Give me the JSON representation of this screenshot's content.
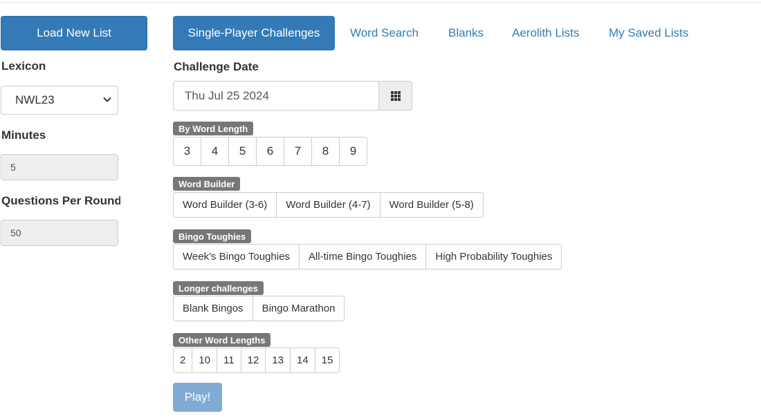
{
  "sidebar": {
    "load_button": "Load New List",
    "lexicon_label": "Lexicon",
    "lexicon_value": "NWL23",
    "minutes_label": "Minutes",
    "minutes_value": "5",
    "qpr_label": "Questions Per Round",
    "qpr_value": "50"
  },
  "tabs": [
    {
      "label": "Single-Player Challenges",
      "active": true
    },
    {
      "label": "Word Search"
    },
    {
      "label": "Blanks"
    },
    {
      "label": "Aerolith Lists"
    },
    {
      "label": "My Saved Lists"
    }
  ],
  "challenge": {
    "date_label": "Challenge Date",
    "date_value": "Thu Jul 25 2024"
  },
  "sections": {
    "by_word_length": {
      "label": "By Word Length",
      "items": [
        "3",
        "4",
        "5",
        "6",
        "7",
        "8",
        "9"
      ]
    },
    "word_builder": {
      "label": "Word Builder",
      "items": [
        "Word Builder (3-6)",
        "Word Builder (4-7)",
        "Word Builder (5-8)"
      ]
    },
    "bingo_toughies": {
      "label": "Bingo Toughies",
      "items": [
        "Week's Bingo Toughies",
        "All-time Bingo Toughies",
        "High Probability Toughies"
      ]
    },
    "longer_challenges": {
      "label": "Longer challenges",
      "items": [
        "Blank Bingos",
        "Bingo Marathon"
      ]
    },
    "other_word_lengths": {
      "label": "Other Word Lengths",
      "items": [
        "2",
        "10",
        "11",
        "12",
        "13",
        "14",
        "15"
      ]
    }
  },
  "play_label": "Play!",
  "icons": {
    "calendar": "grid-calendar-icon",
    "select": "chevron-down-icon"
  },
  "colors": {
    "primary": "#337ab7",
    "tag": "#777777",
    "play_disabled": "#7aa7d3"
  }
}
